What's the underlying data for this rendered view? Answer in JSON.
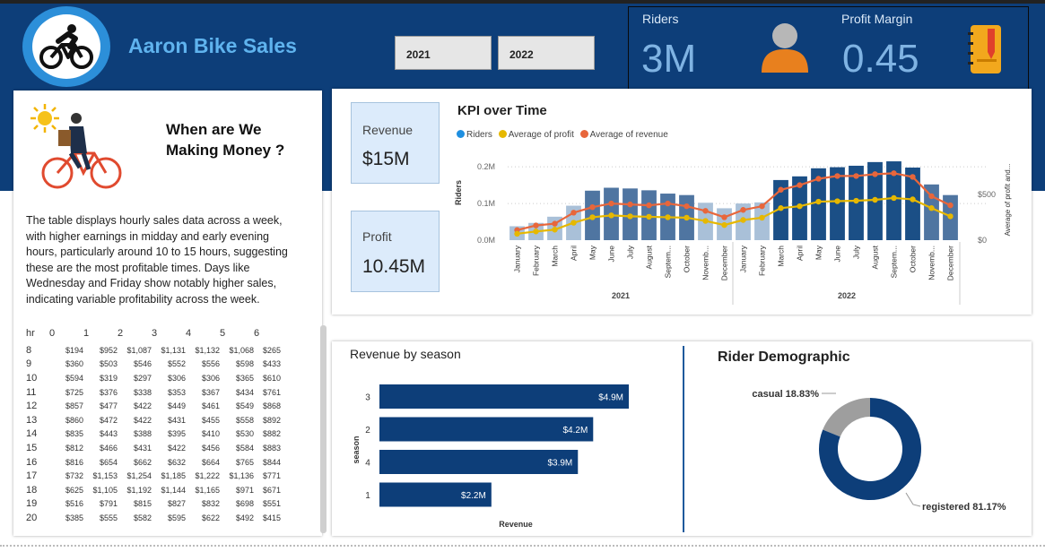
{
  "header": {
    "title": "Aaron Bike Sales",
    "years": [
      "2021",
      "2022"
    ],
    "riders_label": "Riders",
    "riders_value": "3M",
    "margin_label": "Profit Margin",
    "margin_value": "0.45",
    "icons": [
      "bicycle-icon",
      "person-icon",
      "notebook-icon"
    ]
  },
  "info": {
    "title_line1": "When are We",
    "title_line2": "Making Money ?",
    "paragraph": "The table displays hourly sales data across a week, with higher earnings in midday and early evening hours, particularly around 10 to 15 hours, suggesting these are the most profitable times. Days like Wednesday and Friday show notably higher sales, indicating variable profitability across the week.",
    "icons": [
      "sun-icon",
      "cyclist-illustration"
    ]
  },
  "hourly_table": {
    "corner": "hr",
    "columns": [
      "0",
      "1",
      "2",
      "3",
      "4",
      "5",
      "6"
    ],
    "rows": [
      {
        "hr": "8",
        "values": [
          "$194",
          "$952",
          "$1,087",
          "$1,131",
          "$1,132",
          "$1,068",
          "$265"
        ]
      },
      {
        "hr": "9",
        "values": [
          "$360",
          "$503",
          "$546",
          "$552",
          "$556",
          "$598",
          "$433"
        ]
      },
      {
        "hr": "10",
        "values": [
          "$594",
          "$319",
          "$297",
          "$306",
          "$306",
          "$365",
          "$610"
        ]
      },
      {
        "hr": "11",
        "values": [
          "$725",
          "$376",
          "$338",
          "$353",
          "$367",
          "$434",
          "$761"
        ]
      },
      {
        "hr": "12",
        "values": [
          "$857",
          "$477",
          "$422",
          "$449",
          "$461",
          "$549",
          "$868"
        ]
      },
      {
        "hr": "13",
        "values": [
          "$860",
          "$472",
          "$422",
          "$431",
          "$455",
          "$558",
          "$892"
        ]
      },
      {
        "hr": "14",
        "values": [
          "$835",
          "$443",
          "$388",
          "$395",
          "$410",
          "$530",
          "$882"
        ]
      },
      {
        "hr": "15",
        "values": [
          "$812",
          "$466",
          "$431",
          "$422",
          "$456",
          "$584",
          "$883"
        ]
      },
      {
        "hr": "16",
        "values": [
          "$816",
          "$654",
          "$662",
          "$632",
          "$664",
          "$765",
          "$844"
        ]
      },
      {
        "hr": "17",
        "values": [
          "$732",
          "$1,153",
          "$1,254",
          "$1,185",
          "$1,222",
          "$1,136",
          "$771"
        ]
      },
      {
        "hr": "18",
        "values": [
          "$625",
          "$1,105",
          "$1,192",
          "$1,144",
          "$1,165",
          "$971",
          "$671"
        ]
      },
      {
        "hr": "19",
        "values": [
          "$516",
          "$791",
          "$815",
          "$827",
          "$832",
          "$698",
          "$551"
        ]
      },
      {
        "hr": "20",
        "values": [
          "$385",
          "$555",
          "$582",
          "$595",
          "$622",
          "$492",
          "$415"
        ]
      }
    ]
  },
  "cards": {
    "revenue_label": "Revenue",
    "revenue_value": "$15M",
    "profit_label": "Profit",
    "profit_value": "10.45M"
  },
  "colors": {
    "navy": "#0d3e79",
    "bar_dark": "#1b4f86",
    "bar_light": "#a9c0d8",
    "riders_legend": "#1f8fe0",
    "profit_line": "#e6b800",
    "revenue_line": "#e8663b",
    "casual": "#9e9e9e"
  },
  "chart_data": [
    {
      "type": "bar",
      "title": "KPI over Time",
      "legend": [
        "Riders",
        "Average of profit",
        "Average of revenue"
      ],
      "legend_position": "top-left",
      "ylabel": "Riders",
      "y2label": "Average of profit and...",
      "y_ticks": [
        "0.0M",
        "0.1M",
        "0.2M"
      ],
      "y2_ticks": [
        "$0",
        "$500"
      ],
      "ylim": [
        0,
        0.22
      ],
      "y2lim": [
        0,
        880
      ],
      "x_groups": [
        "2021",
        "2022"
      ],
      "categories": [
        "January",
        "February",
        "March",
        "April",
        "May",
        "June",
        "July",
        "August",
        "Septem...",
        "October",
        "Novemb...",
        "December",
        "January",
        "February",
        "March",
        "April",
        "May",
        "June",
        "July",
        "August",
        "Septem...",
        "October",
        "Novemb...",
        "December"
      ],
      "series": [
        {
          "name": "Riders",
          "values": [
            0.038,
            0.047,
            0.064,
            0.094,
            0.135,
            0.143,
            0.141,
            0.136,
            0.127,
            0.123,
            0.102,
            0.087,
            0.1,
            0.103,
            0.164,
            0.174,
            0.196,
            0.199,
            0.203,
            0.213,
            0.215,
            0.198,
            0.152,
            0.123
          ]
        },
        {
          "name": "Average of profit",
          "values": [
            70,
            95,
            115,
            190,
            250,
            270,
            260,
            255,
            250,
            245,
            210,
            165,
            220,
            245,
            350,
            370,
            420,
            425,
            430,
            440,
            460,
            445,
            350,
            260
          ]
        },
        {
          "name": "Average of revenue",
          "values": [
            110,
            160,
            180,
            300,
            360,
            400,
            390,
            380,
            400,
            370,
            320,
            250,
            330,
            370,
            550,
            600,
            670,
            700,
            700,
            720,
            730,
            690,
            480,
            380
          ]
        }
      ]
    },
    {
      "type": "bar",
      "orientation": "horizontal",
      "title": "Revenue by season",
      "xlabel": "Revenue",
      "ylabel": "season",
      "categories": [
        "3",
        "2",
        "4",
        "1"
      ],
      "values": [
        4.9,
        4.2,
        3.9,
        2.2
      ],
      "labels": [
        "$4.9M",
        "$4.2M",
        "$3.9M",
        "$2.2M"
      ]
    },
    {
      "type": "pie",
      "variant": "donut",
      "title": "Rider Demographic",
      "slices": [
        {
          "name": "casual",
          "value": 18.83,
          "label": "casual 18.83%"
        },
        {
          "name": "registered",
          "value": 81.17,
          "label": "registered 81.17%"
        }
      ]
    }
  ]
}
